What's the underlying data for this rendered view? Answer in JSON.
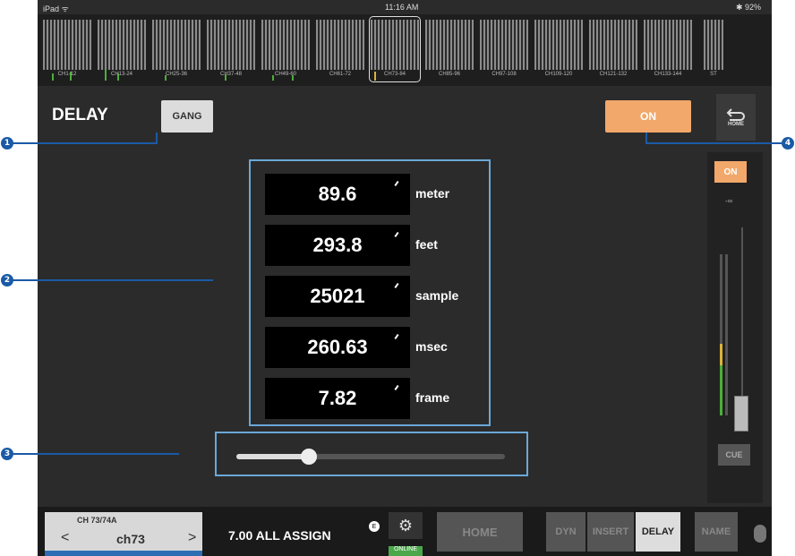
{
  "status": {
    "left": "iPad ᯤ",
    "time": "11:16 AM",
    "right": "✱ 92%"
  },
  "meter_groups": [
    "CH1-12",
    "CH13-24",
    "CH25-36",
    "CH37-48",
    "CH49-60",
    "CH61-72",
    "CH73-84",
    "CH85-96",
    "CH97-108",
    "CH109-120",
    "CH121-132",
    "CH133-144"
  ],
  "stereo_label": "ST",
  "page_title": "DELAY",
  "gang_label": "GANG",
  "on_label": "ON",
  "home_icon_label": "HOME",
  "delay_values": [
    {
      "value": "89.6",
      "unit": "meter"
    },
    {
      "value": "293.8",
      "unit": "feet"
    },
    {
      "value": "25021",
      "unit": "sample"
    },
    {
      "value": "260.63",
      "unit": "msec"
    },
    {
      "value": "7.82",
      "unit": "frame"
    }
  ],
  "delay_slider_level": 0.27,
  "strip": {
    "on_label": "ON",
    "level_text": "-∞",
    "cue_label": "CUE"
  },
  "bottom": {
    "channel_top": "CH 73/74A",
    "channel_name": "ch73",
    "scene": "7.00 ALL ASSIGN",
    "scene_badge": "E",
    "online": "ONLINE",
    "home": "HOME",
    "tabs": [
      "DYN",
      "INSERT",
      "DELAY",
      "NAME"
    ]
  },
  "callouts": [
    "1",
    "2",
    "3",
    "4"
  ]
}
